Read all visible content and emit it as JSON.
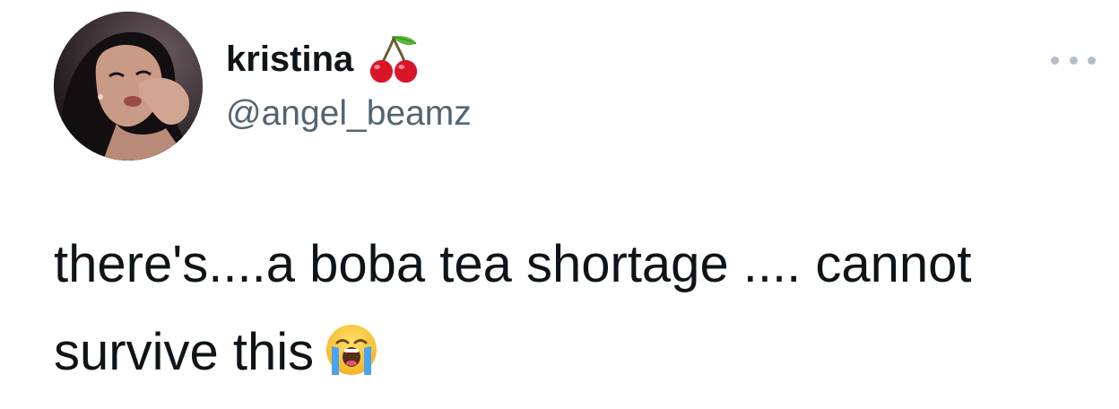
{
  "tweet": {
    "display_name": "kristina",
    "handle": "@angel_beamz",
    "text_line1": "there's....a boba tea shortage .... cannot",
    "text_line2": "survive this",
    "name_emoji": "cherry-icon",
    "text_emoji": "loudly-crying-face-icon",
    "more_icon": "more-options-icon"
  }
}
